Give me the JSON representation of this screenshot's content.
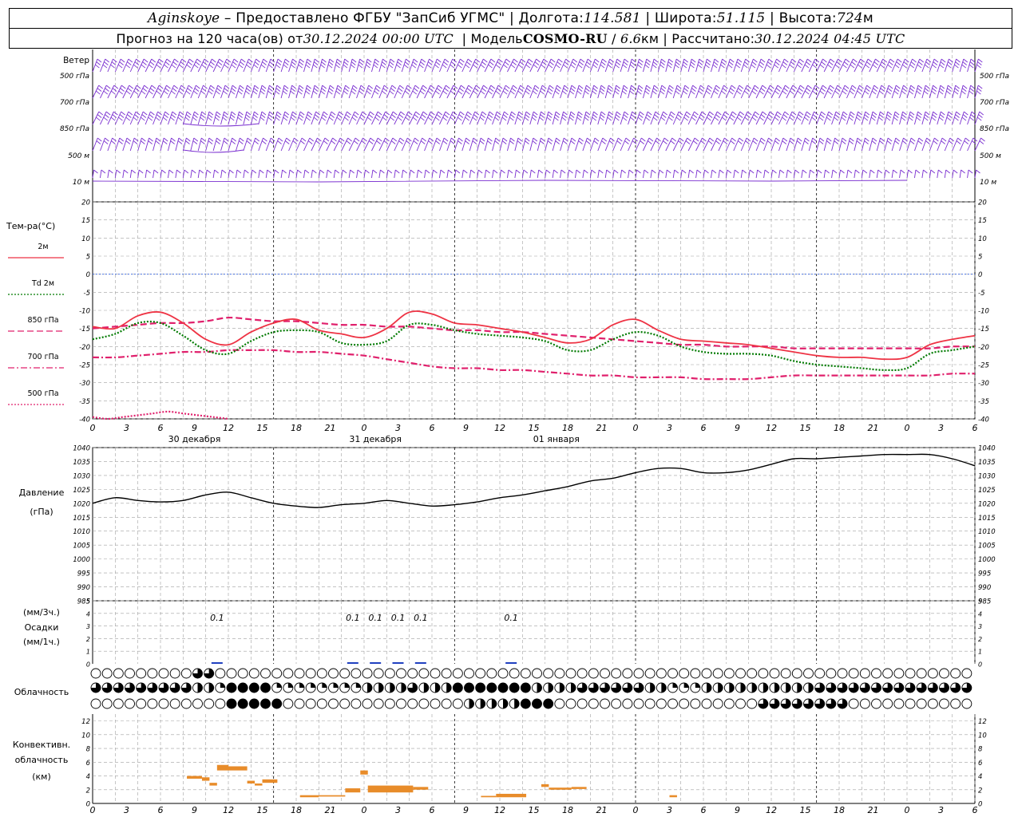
{
  "header": {
    "station": "Aginskoye",
    "provider": "Предоставлено ФГБУ \"ЗапСиб УГМС\"",
    "lon_label": "Долгота:",
    "lon_value": "114.581",
    "lat_label": "Широта:",
    "lat_value": "51.115",
    "alt_label": "Высота:",
    "alt_value": "724",
    "alt_unit": "м",
    "forecast_label": "Прогноз на 120 часа(ов) от",
    "forecast_from": "30.12.2024 00:00 UTC",
    "model_label": "Модель",
    "model": "COSMO-RU",
    "model_res": "6.6",
    "model_res_unit": "км",
    "calc_label": "Рассчитано:",
    "calc_time": "30.12.2024 04:45 UTC"
  },
  "colors": {
    "wind": "#7a2fd0",
    "t2m": "#ee3344",
    "td2m": "#007a00",
    "t850": "#e0206c",
    "t700": "#e0206c",
    "t500": "#e0206c",
    "zero_line": "#3060e0",
    "pressure": "#000000",
    "precip": "#2040c0",
    "convective": "#e88c2a",
    "grid": "#a0a0a0",
    "day_divider": "#000000"
  },
  "chart_data": [
    {
      "type": "barbs",
      "title": "Ветер",
      "levels": [
        "500 гПа",
        "700 гПа",
        "850 гПа",
        "500 м",
        "10  м"
      ],
      "note": "wind barbs at each level every hour"
    },
    {
      "type": "line",
      "title": "Тем-ра(°С)",
      "ylim": [
        -40,
        20
      ],
      "yticks": [
        20,
        15,
        10,
        5,
        0,
        -5,
        -10,
        -15,
        -20,
        -25,
        -30,
        -35,
        -40
      ],
      "legend": [
        {
          "key": "t2m",
          "label": "2м",
          "style": "solid"
        },
        {
          "key": "td2m",
          "label": "Td 2м",
          "style": "dotted"
        },
        {
          "key": "t850",
          "label": "850 гПа",
          "style": "dashed"
        },
        {
          "key": "t700",
          "label": "700 гПа",
          "style": "dashdot"
        },
        {
          "key": "t500",
          "label": "500 гПа",
          "style": "dotted"
        }
      ],
      "x_hours": [
        0,
        3,
        6,
        9,
        12,
        15,
        18,
        21,
        24,
        27,
        30,
        33,
        36,
        39,
        42,
        45,
        48,
        51,
        54,
        57,
        60,
        63,
        66,
        69,
        72,
        75,
        78
      ],
      "series": [
        {
          "key": "t2m",
          "values": [
            -14.5,
            -15,
            -11.5,
            -10.5,
            -13.5,
            -18,
            -19.5,
            -16,
            -13.5,
            -12.5,
            -15.5,
            -16.5,
            -17.5,
            -15,
            -10.5,
            -11,
            -13.5,
            -14,
            -15,
            -16,
            -17.5,
            -19,
            -18,
            -14,
            -12.5,
            -15.5,
            -18
          ]
        },
        {
          "key": "td2m",
          "values": [
            -18,
            -16.5,
            -13.5,
            -13.5,
            -17,
            -21,
            -22,
            -18.5,
            -16,
            -15.5,
            -16,
            -19,
            -19.5,
            -18.5,
            -14,
            -14,
            -15.5,
            -16.5,
            -17,
            -17.5,
            -18.5,
            -21,
            -21,
            -18,
            -16,
            -17,
            -20
          ]
        },
        {
          "key": "t850",
          "values": [
            -15,
            -14.5,
            -14,
            -13.5,
            -13.5,
            -13,
            -12,
            -12.5,
            -13,
            -13,
            -13.5,
            -14,
            -14,
            -14.5,
            -14.5,
            -15,
            -15.5,
            -15.5,
            -16,
            -16,
            -16.5,
            -17,
            -17.5,
            -18,
            -18.5,
            -19,
            -19.5
          ]
        },
        {
          "key": "t700",
          "values": [
            -23,
            -23,
            -22.5,
            -22,
            -21.5,
            -21.5,
            -21,
            -21,
            -21,
            -21.5,
            -21.5,
            -22,
            -22.5,
            -23.5,
            -24.5,
            -25.5,
            -26,
            -26,
            -26.5,
            -26.5,
            -27,
            -27.5,
            -28,
            -28,
            -28.5,
            -28.5,
            -28.5
          ]
        },
        {
          "key": "t500",
          "values": [
            -39.5,
            -40,
            -39.5,
            -39,
            -38.5,
            -38,
            -38.5,
            -39,
            -39.5,
            -40
          ]
        }
      ],
      "series_extra": {
        "t2m_tail": [
          [
            81,
            -18.5
          ],
          [
            84,
            -19
          ],
          [
            87,
            -19.5
          ],
          [
            90,
            -20.5
          ],
          [
            93,
            -21.5
          ],
          [
            96,
            -22.5
          ],
          [
            99,
            -23
          ],
          [
            102,
            -23
          ],
          [
            105,
            -23.5
          ],
          [
            108,
            -23
          ],
          [
            111,
            -19.5
          ],
          [
            114,
            -18
          ],
          [
            117,
            -17
          ]
        ],
        "td2m_tail": [
          [
            81,
            -21.5
          ],
          [
            84,
            -22
          ],
          [
            87,
            -22
          ],
          [
            90,
            -22.5
          ],
          [
            93,
            -24
          ],
          [
            96,
            -25
          ],
          [
            99,
            -25.5
          ],
          [
            102,
            -26
          ],
          [
            105,
            -26.5
          ],
          [
            108,
            -26
          ],
          [
            111,
            -22
          ],
          [
            114,
            -21
          ],
          [
            117,
            -20
          ]
        ],
        "t850_tail": [
          [
            81,
            -19.5
          ],
          [
            84,
            -20
          ],
          [
            87,
            -20
          ],
          [
            90,
            -20
          ],
          [
            93,
            -20.5
          ],
          [
            96,
            -20.5
          ],
          [
            99,
            -20.5
          ],
          [
            102,
            -20.5
          ],
          [
            105,
            -20.5
          ],
          [
            108,
            -20.5
          ],
          [
            111,
            -20.5
          ],
          [
            114,
            -20
          ],
          [
            117,
            -20
          ]
        ],
        "t700_tail": [
          [
            81,
            -29
          ],
          [
            84,
            -29
          ],
          [
            87,
            -29
          ],
          [
            90,
            -28.5
          ],
          [
            93,
            -28
          ],
          [
            96,
            -28
          ],
          [
            99,
            -28
          ],
          [
            102,
            -28
          ],
          [
            105,
            -28
          ],
          [
            108,
            -28
          ],
          [
            111,
            -28
          ],
          [
            114,
            -27.5
          ],
          [
            117,
            -27.5
          ]
        ]
      }
    },
    {
      "type": "line",
      "title": "Давление",
      "unit": "(гПа)",
      "ylim": [
        985,
        1040
      ],
      "yticks": [
        1040,
        1035,
        1030,
        1025,
        1020,
        1015,
        1010,
        1005,
        1000,
        995,
        990,
        985
      ],
      "x_hours": [
        0,
        3,
        6,
        9,
        12,
        15,
        18,
        21,
        24,
        27,
        30,
        33,
        36,
        39,
        42,
        45,
        48,
        51,
        54,
        57,
        60,
        63,
        66,
        69,
        72,
        75,
        78,
        81,
        84,
        87,
        90,
        93,
        96,
        99,
        102,
        105,
        108,
        111,
        114,
        117
      ],
      "values": [
        1020,
        1022,
        1021,
        1020.5,
        1021,
        1023,
        1024,
        1022,
        1020,
        1019,
        1018.5,
        1019.5,
        1020,
        1021,
        1020,
        1019,
        1019.5,
        1020.5,
        1022,
        1023,
        1024.5,
        1026,
        1028,
        1029,
        1031,
        1032.5,
        1032.5,
        1031,
        1031,
        1032,
        1034,
        1036,
        1036,
        1036.5,
        1037,
        1037.5,
        1037.5,
        1037.5,
        1036,
        1033.5
      ]
    },
    {
      "type": "bar",
      "title": "Осадки",
      "unit_3h": "(мм/3ч.)",
      "unit_1h": "(мм/1ч.)",
      "ylim": [
        0,
        5
      ],
      "yticks": [
        5,
        4,
        3,
        2,
        1,
        0
      ],
      "labels": [
        {
          "hour": 16.5,
          "text": "0.1"
        },
        {
          "hour": 34.5,
          "text": "0.1"
        },
        {
          "hour": 37.5,
          "text": "0.1"
        },
        {
          "hour": 40.5,
          "text": "0.1"
        },
        {
          "hour": 43.5,
          "text": "0.1"
        },
        {
          "hour": 55.5,
          "text": "0.1"
        }
      ]
    },
    {
      "type": "table",
      "title": "Облачность",
      "rows": 3,
      "note": "cloud cover symbols (0-8 octas) every hour for high/middle/low layers"
    },
    {
      "type": "bar",
      "title": "Конвективн. облачность",
      "unit": "(км)",
      "ylim": [
        0,
        13
      ],
      "yticks": [
        12,
        10,
        8,
        6,
        4,
        2,
        0
      ],
      "segments": [
        {
          "start": 12.5,
          "end": 14.5,
          "bottom": 3.6,
          "top": 4.0
        },
        {
          "start": 14.5,
          "end": 15.5,
          "bottom": 3.3,
          "top": 3.8
        },
        {
          "start": 15.5,
          "end": 16.5,
          "bottom": 2.6,
          "top": 3.0
        },
        {
          "start": 16.5,
          "end": 18.0,
          "bottom": 4.8,
          "top": 5.6
        },
        {
          "start": 18.0,
          "end": 20.5,
          "bottom": 4.8,
          "top": 5.4
        },
        {
          "start": 20.5,
          "end": 21.5,
          "bottom": 2.9,
          "top": 3.3
        },
        {
          "start": 21.5,
          "end": 22.5,
          "bottom": 2.6,
          "top": 2.9
        },
        {
          "start": 22.5,
          "end": 24.5,
          "bottom": 3.0,
          "top": 3.5
        },
        {
          "start": 27.5,
          "end": 30.0,
          "bottom": 0.9,
          "top": 1.2
        },
        {
          "start": 30.0,
          "end": 33.5,
          "bottom": 1.0,
          "top": 1.2
        },
        {
          "start": 33.5,
          "end": 35.5,
          "bottom": 1.6,
          "top": 2.2
        },
        {
          "start": 35.5,
          "end": 36.5,
          "bottom": 4.2,
          "top": 4.8
        },
        {
          "start": 36.5,
          "end": 42.5,
          "bottom": 1.6,
          "top": 2.6
        },
        {
          "start": 42.5,
          "end": 44.5,
          "bottom": 2.0,
          "top": 2.4
        },
        {
          "start": 51.5,
          "end": 53.5,
          "bottom": 0.9,
          "top": 1.1
        },
        {
          "start": 53.5,
          "end": 57.5,
          "bottom": 0.9,
          "top": 1.4
        },
        {
          "start": 59.5,
          "end": 60.5,
          "bottom": 2.4,
          "top": 2.8
        },
        {
          "start": 60.5,
          "end": 63.5,
          "bottom": 2.0,
          "top": 2.3
        },
        {
          "start": 63.5,
          "end": 65.5,
          "bottom": 2.1,
          "top": 2.4
        },
        {
          "start": 76.5,
          "end": 77.5,
          "bottom": 0.9,
          "top": 1.2
        }
      ]
    },
    {
      "type": "axis",
      "x_tick_labels": [
        "0",
        "3",
        "6",
        "9",
        "12",
        "15",
        "18",
        "21",
        "0",
        "3",
        "6",
        "9",
        "12",
        "15",
        "18",
        "21",
        "0",
        "3",
        "6",
        "9",
        "12",
        "15",
        "18",
        "21",
        "0",
        "3",
        "6"
      ],
      "day_labels": [
        {
          "hour": 12,
          "text": "30 декабря"
        },
        {
          "hour": 36,
          "text": "31 декабря"
        },
        {
          "hour": 60,
          "text": "01 января"
        }
      ]
    }
  ]
}
